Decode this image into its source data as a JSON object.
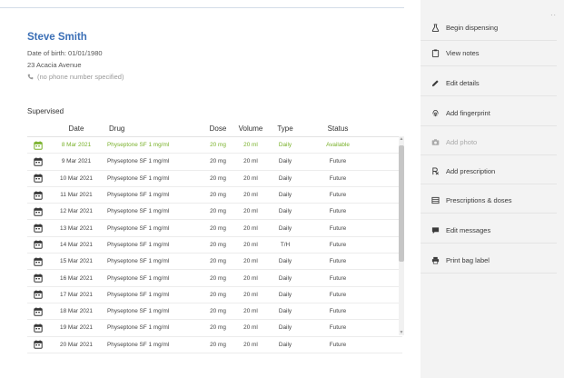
{
  "patient": {
    "name": "Steve Smith",
    "dob": "Date of birth: 01/01/1980",
    "address": "23 Acacia Avenue",
    "phone": "(no phone number specified)"
  },
  "section_title": "Supervised",
  "table": {
    "headers": [
      "Date",
      "Drug",
      "Dose",
      "Volume",
      "Type",
      "Status"
    ],
    "rows": [
      {
        "date": "8 Mar 2021",
        "drug": "Physeptone SF 1 mg/ml",
        "dose": "20 mg",
        "volume": "20 ml",
        "type": "Daily",
        "status": "Available",
        "highlight": true
      },
      {
        "date": "9 Mar 2021",
        "drug": "Physeptone SF 1 mg/ml",
        "dose": "20 mg",
        "volume": "20 ml",
        "type": "Daily",
        "status": "Future"
      },
      {
        "date": "10 Mar 2021",
        "drug": "Physeptone SF 1 mg/ml",
        "dose": "20 mg",
        "volume": "20 ml",
        "type": "Daily",
        "status": "Future"
      },
      {
        "date": "11 Mar 2021",
        "drug": "Physeptone SF 1 mg/ml",
        "dose": "20 mg",
        "volume": "20 ml",
        "type": "Daily",
        "status": "Future"
      },
      {
        "date": "12 Mar 2021",
        "drug": "Physeptone SF 1 mg/ml",
        "dose": "20 mg",
        "volume": "20 ml",
        "type": "Daily",
        "status": "Future"
      },
      {
        "date": "13 Mar 2021",
        "drug": "Physeptone SF 1 mg/ml",
        "dose": "20 mg",
        "volume": "20 ml",
        "type": "Daily",
        "status": "Future"
      },
      {
        "date": "14 Mar 2021",
        "drug": "Physeptone SF 1 mg/ml",
        "dose": "20 mg",
        "volume": "20 ml",
        "type": "T/H",
        "status": "Future"
      },
      {
        "date": "15 Mar 2021",
        "drug": "Physeptone SF 1 mg/ml",
        "dose": "20 mg",
        "volume": "20 ml",
        "type": "Daily",
        "status": "Future"
      },
      {
        "date": "16 Mar 2021",
        "drug": "Physeptone SF 1 mg/ml",
        "dose": "20 mg",
        "volume": "20 ml",
        "type": "Daily",
        "status": "Future"
      },
      {
        "date": "17 Mar 2021",
        "drug": "Physeptone SF 1 mg/ml",
        "dose": "20 mg",
        "volume": "20 ml",
        "type": "Daily",
        "status": "Future"
      },
      {
        "date": "18 Mar 2021",
        "drug": "Physeptone SF 1 mg/ml",
        "dose": "20 mg",
        "volume": "20 ml",
        "type": "Daily",
        "status": "Future"
      },
      {
        "date": "19 Mar 2021",
        "drug": "Physeptone SF 1 mg/ml",
        "dose": "20 mg",
        "volume": "20 ml",
        "type": "Daily",
        "status": "Future"
      },
      {
        "date": "20 Mar 2021",
        "drug": "Physeptone SF 1 mg/ml",
        "dose": "20 mg",
        "volume": "20 ml",
        "type": "Daily",
        "status": "Future"
      }
    ]
  },
  "actions": [
    {
      "label": "Begin dispensing",
      "icon": "beaker-icon",
      "disabled": false
    },
    {
      "label": "View notes",
      "icon": "clipboard-icon",
      "disabled": false
    },
    {
      "label": "Edit details",
      "icon": "pencil-icon",
      "disabled": false
    },
    {
      "label": "Add fingerprint",
      "icon": "fingerprint-icon",
      "disabled": false
    },
    {
      "label": "Add photo",
      "icon": "camera-icon",
      "disabled": true
    },
    {
      "label": "Add prescription",
      "icon": "prescription-icon",
      "disabled": false
    },
    {
      "label": "Prescriptions & doses",
      "icon": "list-icon",
      "disabled": false
    },
    {
      "label": "Edit messages",
      "icon": "message-icon",
      "disabled": false
    },
    {
      "label": "Print bag label",
      "icon": "printer-icon",
      "disabled": false
    }
  ],
  "colors": {
    "accent": "#3b6fb6",
    "available": "#79b12a",
    "panel_bg": "#f3f3f3"
  },
  "close_label": "×"
}
